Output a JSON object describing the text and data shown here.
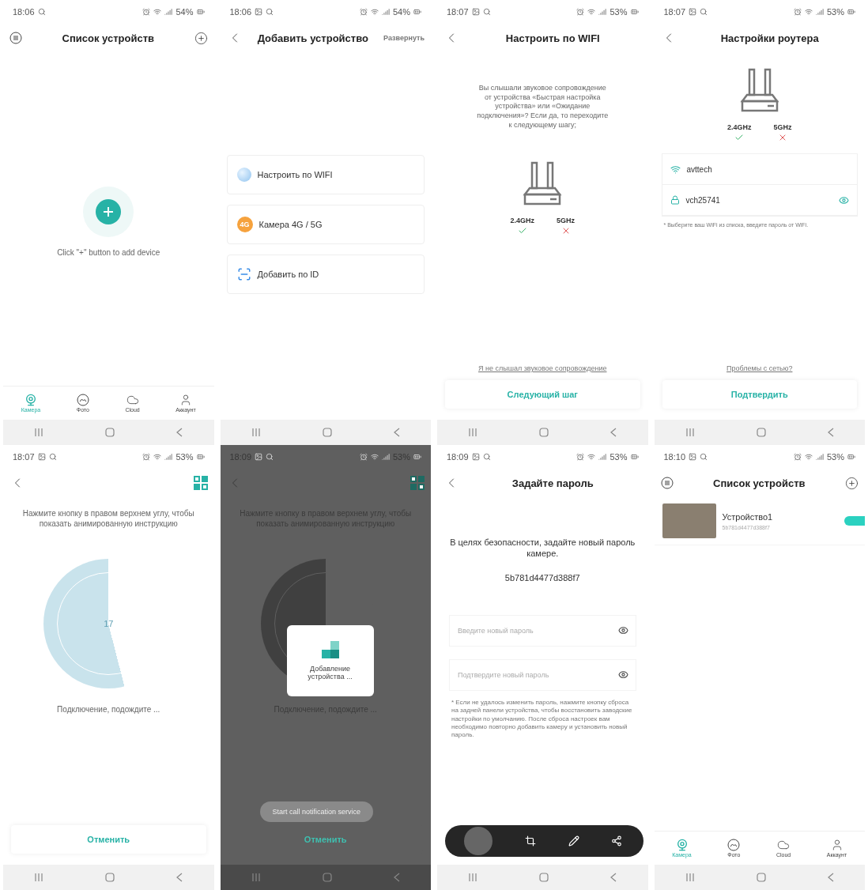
{
  "screens": [
    {
      "kind": "device-list-empty",
      "status": {
        "time": "18:06",
        "gallery": false,
        "battery": "54%"
      },
      "header": {
        "title": "Список устройств"
      },
      "hint": "Click \"+\" button to add device",
      "tabs": [
        {
          "label": "Камера",
          "selected": true
        },
        {
          "label": "Фото",
          "selected": false
        },
        {
          "label": "Cloud",
          "selected": false
        },
        {
          "label": "Аккаунт",
          "selected": false
        }
      ]
    },
    {
      "kind": "add-device",
      "status": {
        "time": "18:06",
        "gallery": true,
        "battery": "54%"
      },
      "header": {
        "title": "Добавить устройство",
        "action": "Развернуть"
      },
      "options": [
        {
          "label": "Настроить по WIFI"
        },
        {
          "badge": "4G",
          "label": "Камера 4G / 5G"
        },
        {
          "label": "Добавить по ID"
        }
      ]
    },
    {
      "kind": "wifi-setup",
      "status": {
        "time": "18:07",
        "gallery": true,
        "battery": "53%"
      },
      "header": {
        "title": "Настроить по WIFI"
      },
      "text": "Вы слышали звуковое сопровождение от устройства «Быстрая настройка устройства» или «Ожидание подключения»? Если да, то переходите к следующему шагу;",
      "bands": [
        {
          "label": "2.4GHz",
          "supported": true
        },
        {
          "label": "5GHz",
          "supported": false
        }
      ],
      "link": "Я не слышал звуковое сопровождение",
      "button": "Следующий шаг"
    },
    {
      "kind": "router",
      "status": {
        "time": "18:07",
        "gallery": true,
        "battery": "53%"
      },
      "header": {
        "title": "Настройки роутера"
      },
      "bands": [
        {
          "label": "2.4GHz",
          "supported": true
        },
        {
          "label": "5GHz",
          "supported": false
        }
      ],
      "network": "avttech",
      "password": "vch25741",
      "note": "* Выберите ваш WiFi из списка, введите пароль от WiFi.",
      "link": "Проблемы с сетью?",
      "button": "Подтвердить"
    },
    {
      "kind": "connecting",
      "dimmed": false,
      "status": {
        "time": "18:07",
        "gallery": true,
        "battery": "53%"
      },
      "text": "Нажмите кнопку в правом верхнем углу, чтобы показать анимированную инструкцию",
      "progress": "17",
      "message": "Подключение, подождите ...",
      "button": "Отменить"
    },
    {
      "kind": "connecting",
      "dimmed": true,
      "status": {
        "time": "18:09",
        "gallery": true,
        "battery": "53%"
      },
      "text": "Нажмите кнопку в правом верхнем углу, чтобы показать анимированную инструкцию",
      "message": "Подключение, подождите ...",
      "button": "Отменить",
      "dialog": "Добавление устройства ...",
      "toast": "Start call notification service"
    },
    {
      "kind": "password",
      "status": {
        "time": "18:09",
        "gallery": true,
        "battery": "53%"
      },
      "header": {
        "title": "Задайте пароль"
      },
      "intro": "В целях безопасности, задайте новый пароль камере.",
      "device_id": "5b781d4477d388f7",
      "fields": [
        {
          "placeholder": "Введите новый пароль"
        },
        {
          "placeholder": "Подтвердите новый пароль"
        }
      ],
      "note": "* Если не удалось изменить пароль, нажмите кнопку сброса на задней панели устройства, чтобы восстановить заводские настройки по умолчанию. После сброса настроек вам необходимо повторно добавить камеру и установить новый пароль."
    },
    {
      "kind": "device-list",
      "status": {
        "time": "18:10",
        "gallery": true,
        "battery": "53%"
      },
      "header": {
        "title": "Список устройств"
      },
      "devices": [
        {
          "name": "Устройство1",
          "id": "5b781d4477d388f7"
        }
      ],
      "tabs": [
        {
          "label": "Камера",
          "selected": true
        },
        {
          "label": "Фото",
          "selected": false
        },
        {
          "label": "Cloud",
          "selected": false
        },
        {
          "label": "Аккаунт",
          "selected": false
        }
      ]
    }
  ]
}
